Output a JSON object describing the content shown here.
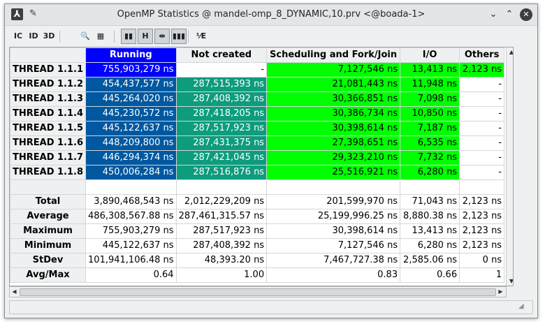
{
  "window": {
    "title": "OpenMP Statistics @ mandel-omp_8_DYNAMIC,10.prv <@boada-1>",
    "app_icon": "paraver-icon",
    "controls": [
      "minimize-icon",
      "maximize-icon",
      "close-icon"
    ]
  },
  "toolbar": {
    "buttons": [
      {
        "name": "control-window-icon",
        "glyph": "IC"
      },
      {
        "name": "data-window-icon",
        "glyph": "ID"
      },
      {
        "name": "3d-window-icon",
        "glyph": "3D"
      },
      {
        "name": "zoom-icon",
        "glyph": "🔍"
      },
      {
        "name": "open-filter-icon",
        "glyph": "▦"
      },
      {
        "name": "gradient-color-icon",
        "glyph": "▮▮"
      },
      {
        "name": "hide-empty-icon",
        "glyph": "H"
      },
      {
        "name": "fit-columns-icon",
        "glyph": "⇹"
      },
      {
        "name": "semantic-color-icon",
        "glyph": "▮▮▮"
      },
      {
        "name": "label-mode-icon",
        "glyph": "⅟E"
      }
    ]
  },
  "table": {
    "columns": [
      "Running",
      "Not created",
      "Scheduling and Fork/Join",
      "I/O",
      "Others"
    ],
    "header_colors": [
      "#0000ff",
      "#ffffff",
      "#ffff00",
      "#a0a028",
      "#b3e61a"
    ],
    "rows": [
      {
        "label": "THREAD 1.1.1",
        "cells": [
          "755,903,279 ns",
          "-",
          "7,127,546 ns",
          "13,413 ns",
          "2,123 ns"
        ]
      },
      {
        "label": "THREAD 1.1.2",
        "cells": [
          "454,437,577 ns",
          "287,515,393 ns",
          "21,081,443 ns",
          "11,948 ns",
          "-"
        ]
      },
      {
        "label": "THREAD 1.1.3",
        "cells": [
          "445,264,020 ns",
          "287,408,392 ns",
          "30,366,851 ns",
          "7,098 ns",
          "-"
        ]
      },
      {
        "label": "THREAD 1.1.4",
        "cells": [
          "445,230,572 ns",
          "287,418,205 ns",
          "30,386,734 ns",
          "10,850 ns",
          "-"
        ]
      },
      {
        "label": "THREAD 1.1.5",
        "cells": [
          "445,122,637 ns",
          "287,517,923 ns",
          "30,398,614 ns",
          "7,187 ns",
          "-"
        ]
      },
      {
        "label": "THREAD 1.1.6",
        "cells": [
          "448,209,800 ns",
          "287,431,375 ns",
          "27,398,651 ns",
          "6,535 ns",
          "-"
        ]
      },
      {
        "label": "THREAD 1.1.7",
        "cells": [
          "446,294,374 ns",
          "287,421,045 ns",
          "29,323,210 ns",
          "7,732 ns",
          "-"
        ]
      },
      {
        "label": "THREAD 1.1.8",
        "cells": [
          "450,006,284 ns",
          "287,516,876 ns",
          "25,516,921 ns",
          "6,280 ns",
          "-"
        ]
      }
    ],
    "stats": [
      {
        "label": "Total",
        "cells": [
          "3,890,468,543 ns",
          "2,012,229,209 ns",
          "201,599,970 ns",
          "71,043 ns",
          "2,123 ns"
        ]
      },
      {
        "label": "Average",
        "cells": [
          "486,308,567.88 ns",
          "287,461,315.57 ns",
          "25,199,996.25 ns",
          "8,880.38 ns",
          "2,123 ns"
        ]
      },
      {
        "label": "Maximum",
        "cells": [
          "755,903,279 ns",
          "287,517,923 ns",
          "30,398,614 ns",
          "13,413 ns",
          "2,123 ns"
        ]
      },
      {
        "label": "Minimum",
        "cells": [
          "445,122,637 ns",
          "287,408,392 ns",
          "7,127,546 ns",
          "6,280 ns",
          "2,123 ns"
        ]
      },
      {
        "label": "StDev",
        "cells": [
          "101,941,106.48 ns",
          "48,393.20 ns",
          "7,467,727.38 ns",
          "2,585.06 ns",
          "0 ns"
        ]
      },
      {
        "label": "Avg/Max",
        "cells": [
          "0.64",
          "1.00",
          "0.83",
          "0.66",
          "1"
        ]
      }
    ]
  }
}
